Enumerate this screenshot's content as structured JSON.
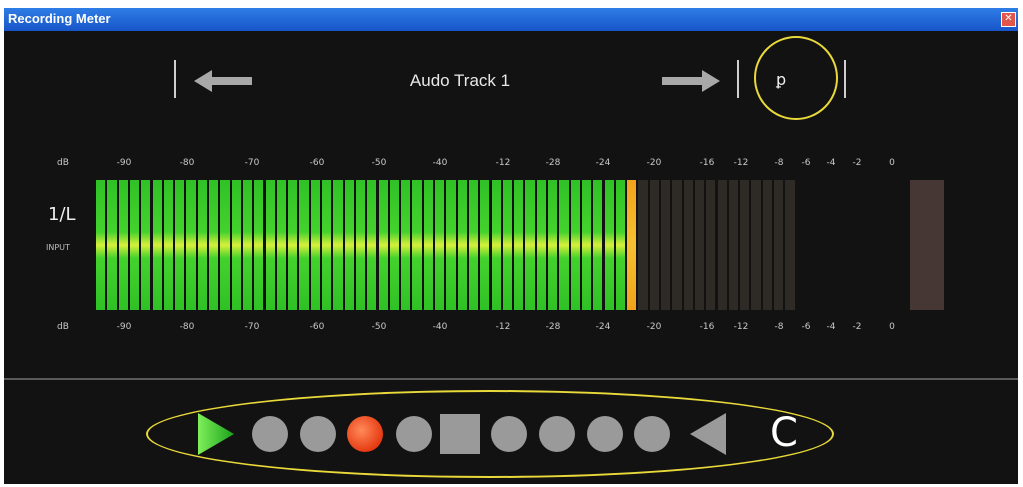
{
  "window": {
    "title": "Recording Meter",
    "close_glyph": "✕",
    "accent": "#e9d93a"
  },
  "header": {
    "prev_icon": "arrow-left-icon",
    "track_name": "Audo Track 1",
    "next_icon": "arrow-right-icon",
    "pin_icon": "pushpin-icon",
    "pin_glyph": "ꝑ"
  },
  "meter": {
    "channel_label": "1/L",
    "input_label": "INPUT",
    "db_label": "dB",
    "scale_ticks": [
      "-90",
      "-80",
      "-70",
      "-60",
      "-50",
      "-40",
      "-12",
      "-28",
      "-24",
      "-20",
      "-16",
      "-12",
      "-8",
      "-6",
      "-4",
      "-2",
      "0"
    ],
    "level_fraction": 0.77,
    "colors": {
      "lit": "#2fc125",
      "peak": "#f1a21c",
      "unlit": "#2e2a26",
      "clip": "#473734"
    }
  },
  "transport": {
    "buttons": [
      {
        "icon": "play-icon",
        "state": "default"
      },
      {
        "icon": "circle-icon",
        "state": "inactive"
      },
      {
        "icon": "circle-icon",
        "state": "inactive"
      },
      {
        "icon": "record-icon",
        "state": "active"
      },
      {
        "icon": "circle-icon",
        "state": "inactive"
      },
      {
        "icon": "stop-icon",
        "state": "inactive"
      },
      {
        "icon": "circle-icon",
        "state": "inactive"
      },
      {
        "icon": "circle-icon",
        "state": "inactive"
      },
      {
        "icon": "circle-icon",
        "state": "inactive"
      },
      {
        "icon": "circle-icon",
        "state": "inactive"
      },
      {
        "icon": "rewind-triangle-icon",
        "state": "inactive"
      }
    ],
    "clear_label": "C"
  }
}
